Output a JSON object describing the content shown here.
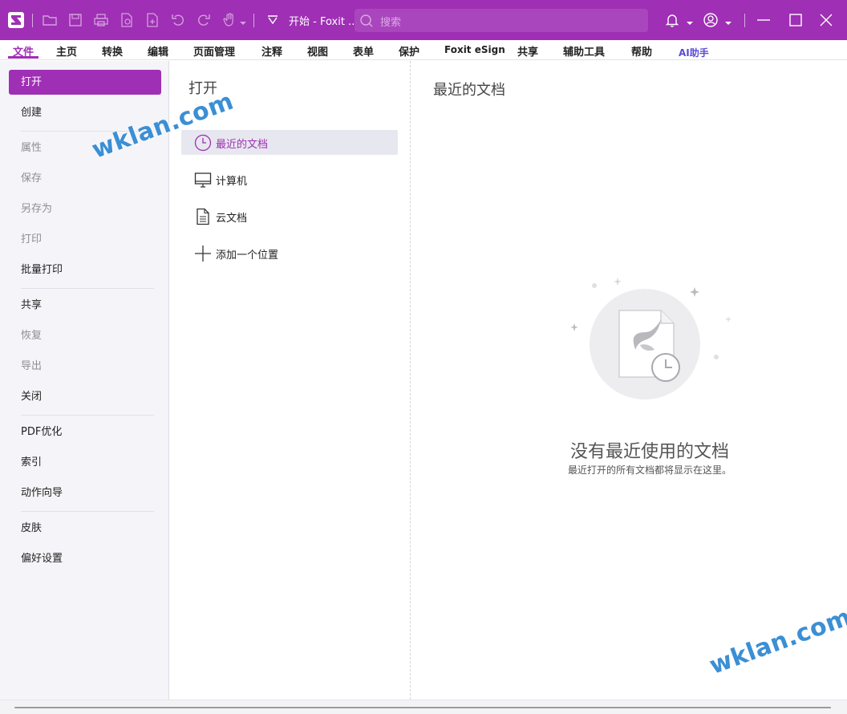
{
  "titlebar": {
    "title": "开始 - Foxit ...",
    "search_placeholder": "搜索",
    "color": "#9f2fb4"
  },
  "menu": {
    "tabs": [
      {
        "label": "文件",
        "active": true
      },
      {
        "label": "主页"
      },
      {
        "label": "转换"
      },
      {
        "label": "编辑"
      },
      {
        "label": "页面管理"
      },
      {
        "label": "注释"
      },
      {
        "label": "视图"
      },
      {
        "label": "表单"
      },
      {
        "label": "保护"
      },
      {
        "label": "Foxit eSign"
      },
      {
        "label": "共享"
      },
      {
        "label": "辅助工具"
      },
      {
        "label": "帮助"
      },
      {
        "label": "AI助手"
      }
    ]
  },
  "sidebar": {
    "items": [
      {
        "label": "打开",
        "state": "active"
      },
      {
        "label": "创建",
        "state": "enabled"
      },
      {
        "label": "属性",
        "state": "disabled"
      },
      {
        "label": "保存",
        "state": "disabled"
      },
      {
        "label": "另存为",
        "state": "disabled"
      },
      {
        "label": "打印",
        "state": "disabled"
      },
      {
        "label": "批量打印",
        "state": "enabled"
      },
      {
        "label": "共享",
        "state": "enabled"
      },
      {
        "label": "恢复",
        "state": "disabled"
      },
      {
        "label": "导出",
        "state": "disabled"
      },
      {
        "label": "关闭",
        "state": "enabled"
      },
      {
        "label": "PDF优化",
        "state": "enabled"
      },
      {
        "label": "索引",
        "state": "enabled"
      },
      {
        "label": "动作向导",
        "state": "enabled"
      },
      {
        "label": "皮肤",
        "state": "enabled"
      },
      {
        "label": "偏好设置",
        "state": "enabled"
      }
    ]
  },
  "open_panel": {
    "heading": "打开",
    "locations": [
      {
        "label": "最近的文档",
        "icon": "clock-icon",
        "active": true
      },
      {
        "label": "计算机",
        "icon": "monitor-icon"
      },
      {
        "label": "云文档",
        "icon": "document-icon"
      },
      {
        "label": "添加一个位置",
        "icon": "plus-icon"
      }
    ]
  },
  "recent_panel": {
    "heading": "最近的文档",
    "empty_title": "没有最近使用的文档",
    "empty_subtitle": "最近打开的所有文档都将显示在这里。"
  },
  "watermark": {
    "text": "wklan.com"
  }
}
